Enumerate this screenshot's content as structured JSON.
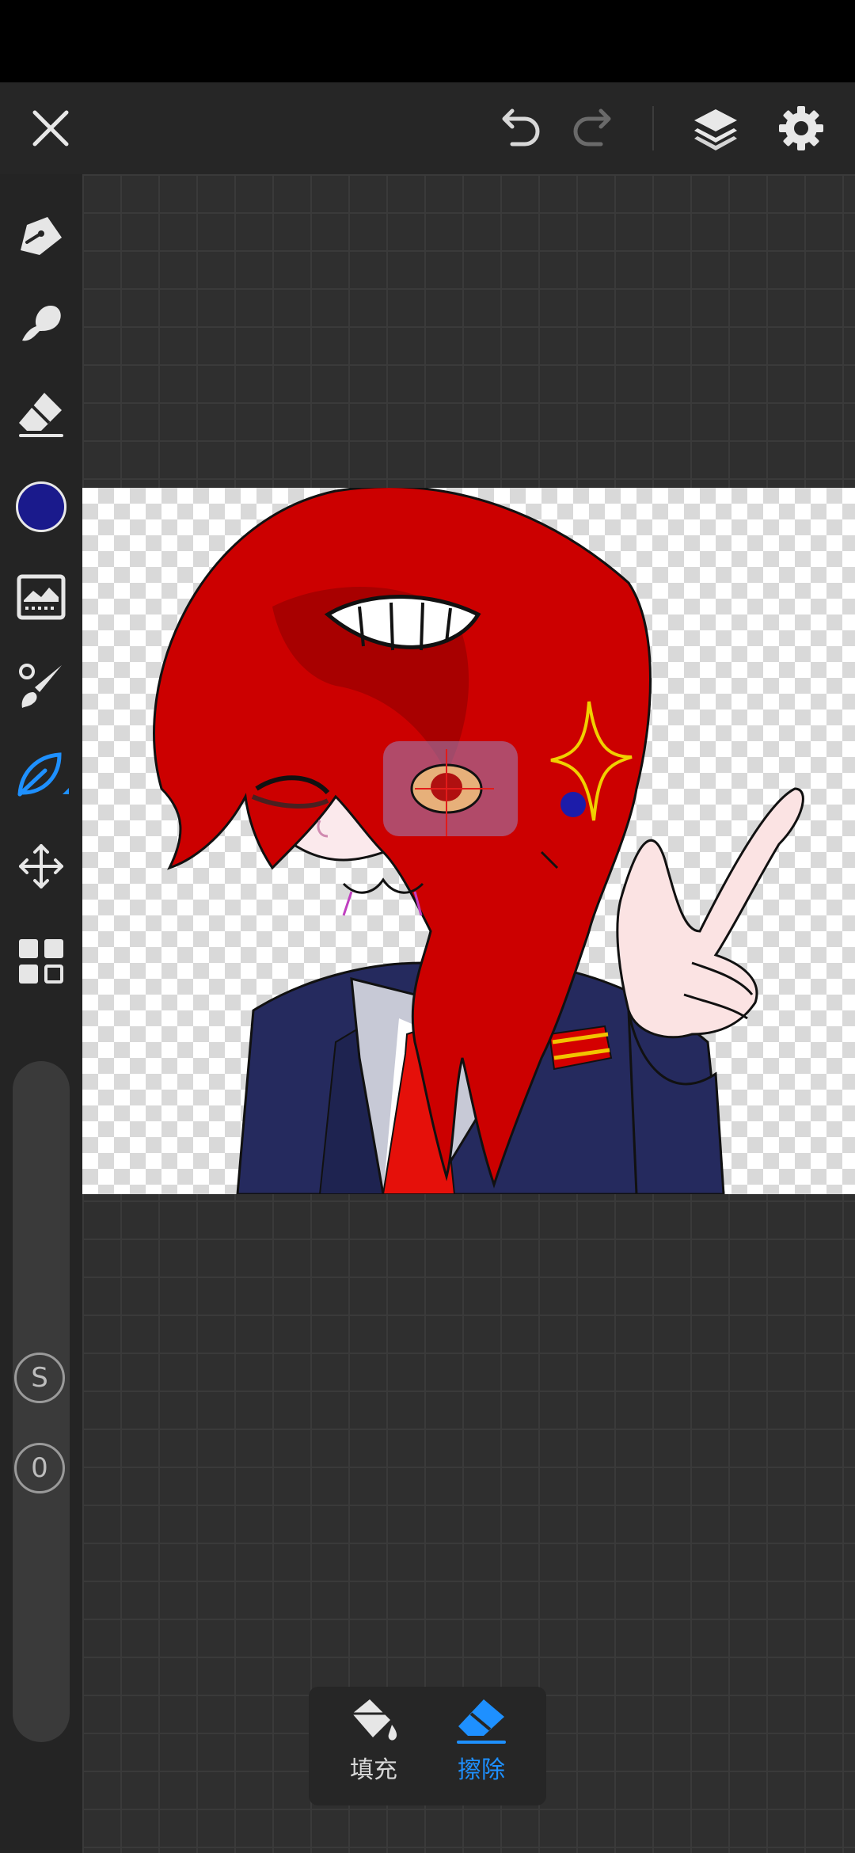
{
  "top_bar": {
    "close_icon": "close-icon",
    "undo_icon": "undo-icon",
    "redo_icon": "redo-icon",
    "layers_icon": "layers-icon",
    "settings_icon": "gear-icon"
  },
  "tools": [
    {
      "name": "pen-tool",
      "icon": "pen-icon"
    },
    {
      "name": "smudge-tool",
      "icon": "smudge-icon"
    },
    {
      "name": "eraser-tool",
      "icon": "eraser-icon"
    },
    {
      "name": "color-picker",
      "icon": "color-swatch",
      "color": "#1a1a8c"
    },
    {
      "name": "adjust-tool",
      "icon": "image-adjust-icon"
    },
    {
      "name": "brush-tool",
      "icon": "brush-icon"
    },
    {
      "name": "lasso-fill-tool",
      "icon": "lasso-leaf-icon",
      "active": true,
      "color": "#1e90ff"
    },
    {
      "name": "transform-tool",
      "icon": "move-arrows-icon"
    },
    {
      "name": "gallery-tool",
      "icon": "grid-icon"
    }
  ],
  "side_controls": {
    "size_badge": "S",
    "opacity_badge": "0"
  },
  "popup": {
    "fill_label": "填充",
    "erase_label": "擦除",
    "active": "erase",
    "active_color": "#1e90ff"
  }
}
